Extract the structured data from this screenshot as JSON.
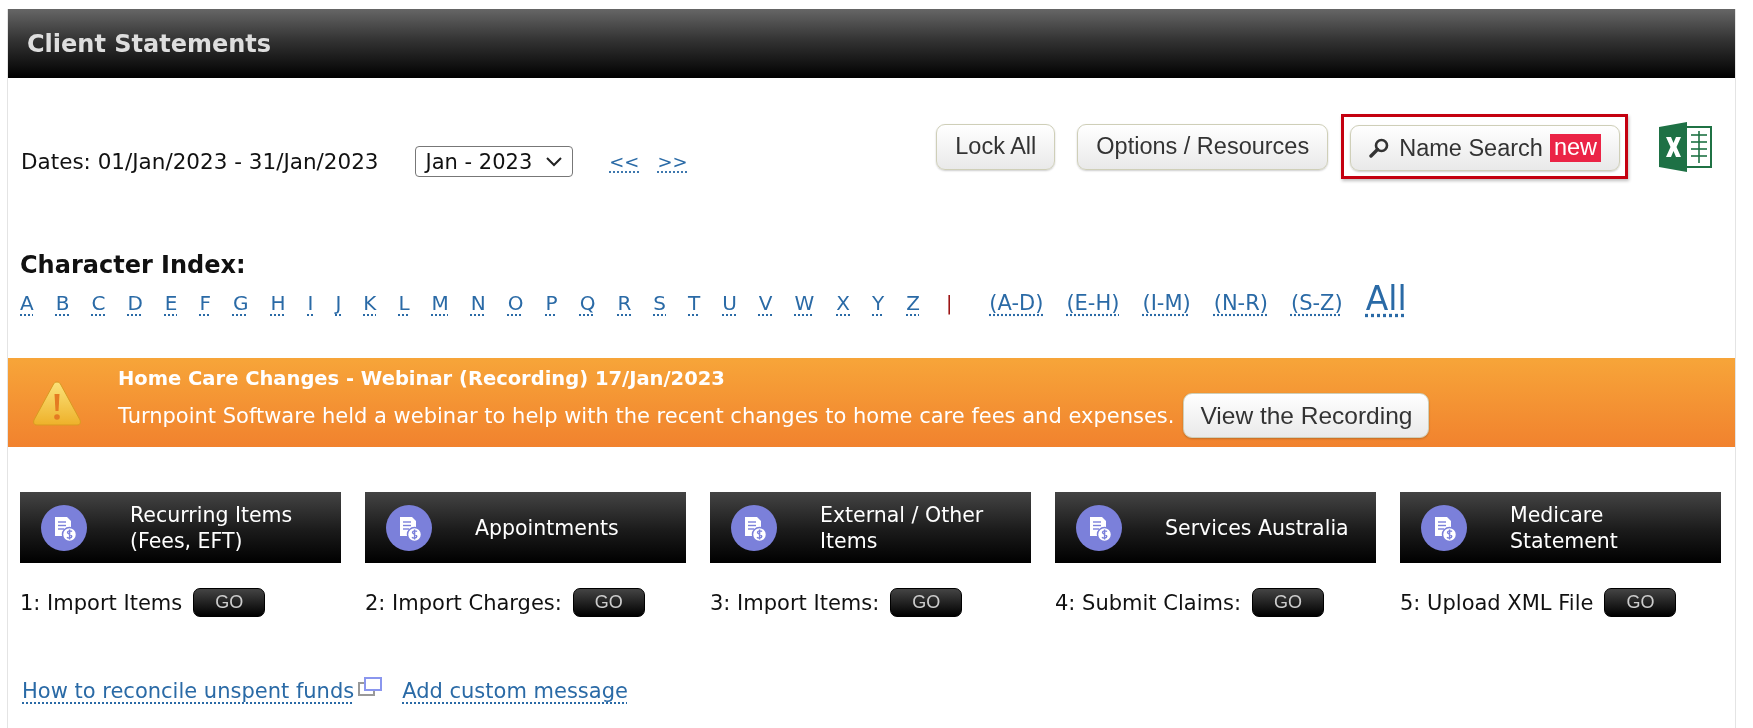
{
  "header": {
    "title": "Client Statements"
  },
  "period": {
    "label": "Dates: 01/Jan/2023 - 31/Jan/2023",
    "month": "Jan - 2023",
    "previous": "<<",
    "next": ">>"
  },
  "toolbar": {
    "buttons": [
      {
        "label": "Lock All",
        "kind": "plain",
        "highlighted": false
      },
      {
        "label": "Options / Resources",
        "kind": "plain",
        "highlighted": false
      },
      {
        "label": "Name Search",
        "kind": "search",
        "badge": "new",
        "highlighted": true
      }
    ]
  },
  "character_index": {
    "title": "Character Index:",
    "letters": [
      "A",
      "B",
      "C",
      "D",
      "E",
      "F",
      "G",
      "H",
      "I",
      "J",
      "K",
      "L",
      "M",
      "N",
      "O",
      "P",
      "Q",
      "R",
      "S",
      "T",
      "U",
      "V",
      "W",
      "X",
      "Y",
      "Z"
    ],
    "separator": "|",
    "ranges": [
      "(A-D)",
      "(E-H)",
      "(I-M)",
      "(N-R)",
      "(S-Z)"
    ],
    "all": "All"
  },
  "banner": {
    "title": "Home Care Changes - Webinar (Recording) 17/Jan/2023",
    "message": "Turnpoint Software held a webinar to help with the recent changes to home care fees and expenses.",
    "button": "View the Recording"
  },
  "steps": [
    {
      "title_lines": [
        "Recurring Items",
        "(Fees, EFT)"
      ],
      "action": "1: Import Items",
      "button": "GO"
    },
    {
      "title_lines": [
        "Appointments"
      ],
      "action": "2: Import Charges:",
      "button": "GO"
    },
    {
      "title_lines": [
        "External / Other",
        "Items"
      ],
      "action": "3: Import Items:",
      "button": "GO"
    },
    {
      "title_lines": [
        "Services Australia"
      ],
      "action": "4: Submit Claims:",
      "button": "GO"
    },
    {
      "title_lines": [
        "Medicare",
        "Statement"
      ],
      "action": "5: Upload XML File",
      "button": "GO"
    }
  ],
  "links": [
    {
      "label": "How to reconcile unspent funds",
      "opens_window": true
    },
    {
      "label": "Add custom message",
      "opens_window": false
    }
  ]
}
